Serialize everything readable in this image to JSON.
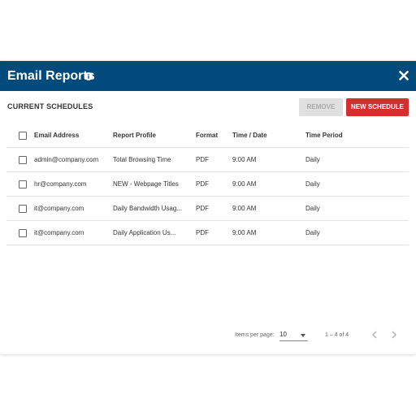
{
  "dialog": {
    "title": "Email Reports",
    "colors": {
      "header_bg": "#004b7c",
      "primary_button": "#d32f2f",
      "disabled_button": "#e0e0e0"
    }
  },
  "toolbar": {
    "section_title": "CURRENT SCHEDULES",
    "remove_label": "REMOVE",
    "new_schedule_label": "NEW SCHEDULE"
  },
  "table": {
    "columns": [
      "Email Address",
      "Report Profile",
      "Format",
      "Time / Date",
      "Time Period"
    ],
    "rows": [
      {
        "email": "admin@company.com",
        "profile": "Total Browsing Time",
        "format": "PDF",
        "time": "9:00 AM",
        "period": "Daily"
      },
      {
        "email": "hr@company.com",
        "profile": "NEW - Webpage Titles",
        "format": "PDF",
        "time": "9:00 AM",
        "period": "Daily"
      },
      {
        "email": "it@company.com",
        "profile": "Daily Bandwidth Usag...",
        "format": "PDF",
        "time": "9:00 AM",
        "period": "Daily"
      },
      {
        "email": "it@company.com",
        "profile": "Daily Application Us...",
        "format": "PDF",
        "time": "9:00 AM",
        "period": "Daily"
      }
    ]
  },
  "paginator": {
    "items_per_page_label": "Items per page:",
    "items_per_page_value": "10",
    "range_label": "1 – 4 of 4"
  }
}
